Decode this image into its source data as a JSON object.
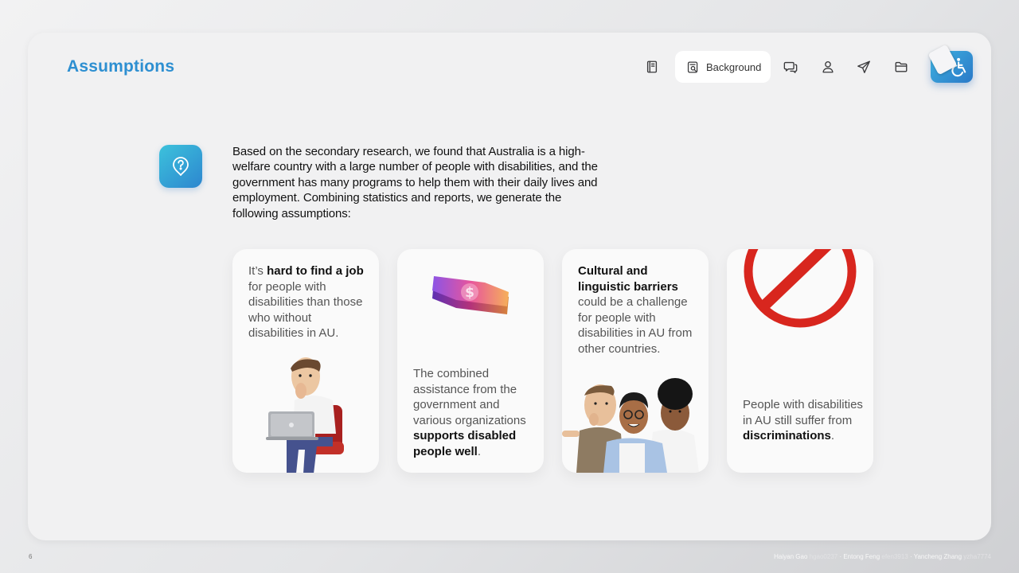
{
  "header": {
    "title": "Assumptions"
  },
  "nav": {
    "active_label": "Background",
    "items": [
      "notebook-icon",
      "search-document-icon",
      "chat-icon",
      "user-icon",
      "send-icon",
      "folder-icon"
    ]
  },
  "intro": {
    "text": "Based on the secondary research, we found that Australia is a high-welfare country with a large number of people with disabilities, and the government has many programs to help them with their daily lives and employment. Combining statistics and reports, we generate the following assumptions:"
  },
  "cards": [
    {
      "pre": "It’s ",
      "bold": "hard to find a job",
      "post": " for people with disabilities than those who without disabilities in AU."
    },
    {
      "pre": "The combined assistance from the government and various organizations ",
      "bold": "supports disabled people well",
      "post": "."
    },
    {
      "pre": "",
      "bold": "Cultural and linguistic barriers",
      "post": " could be a challenge for people with disabilities in AU from other countries."
    },
    {
      "pre": "People with disabilities in AU still suffer from ",
      "bold": "discriminations",
      "post": "."
    }
  ],
  "card_money_symbol": "$",
  "footer": {
    "page_number": "6",
    "credits": [
      {
        "name": "Haiyan Gao",
        "id": "hgao0237"
      },
      {
        "name": "Entong Feng",
        "id": "efen3913"
      },
      {
        "name": "Yancheng Zhang",
        "id": "yzha7774"
      }
    ],
    "separator": " · "
  },
  "colors": {
    "accent": "#2d8fd1",
    "prohibition_red": "#d8261e"
  }
}
